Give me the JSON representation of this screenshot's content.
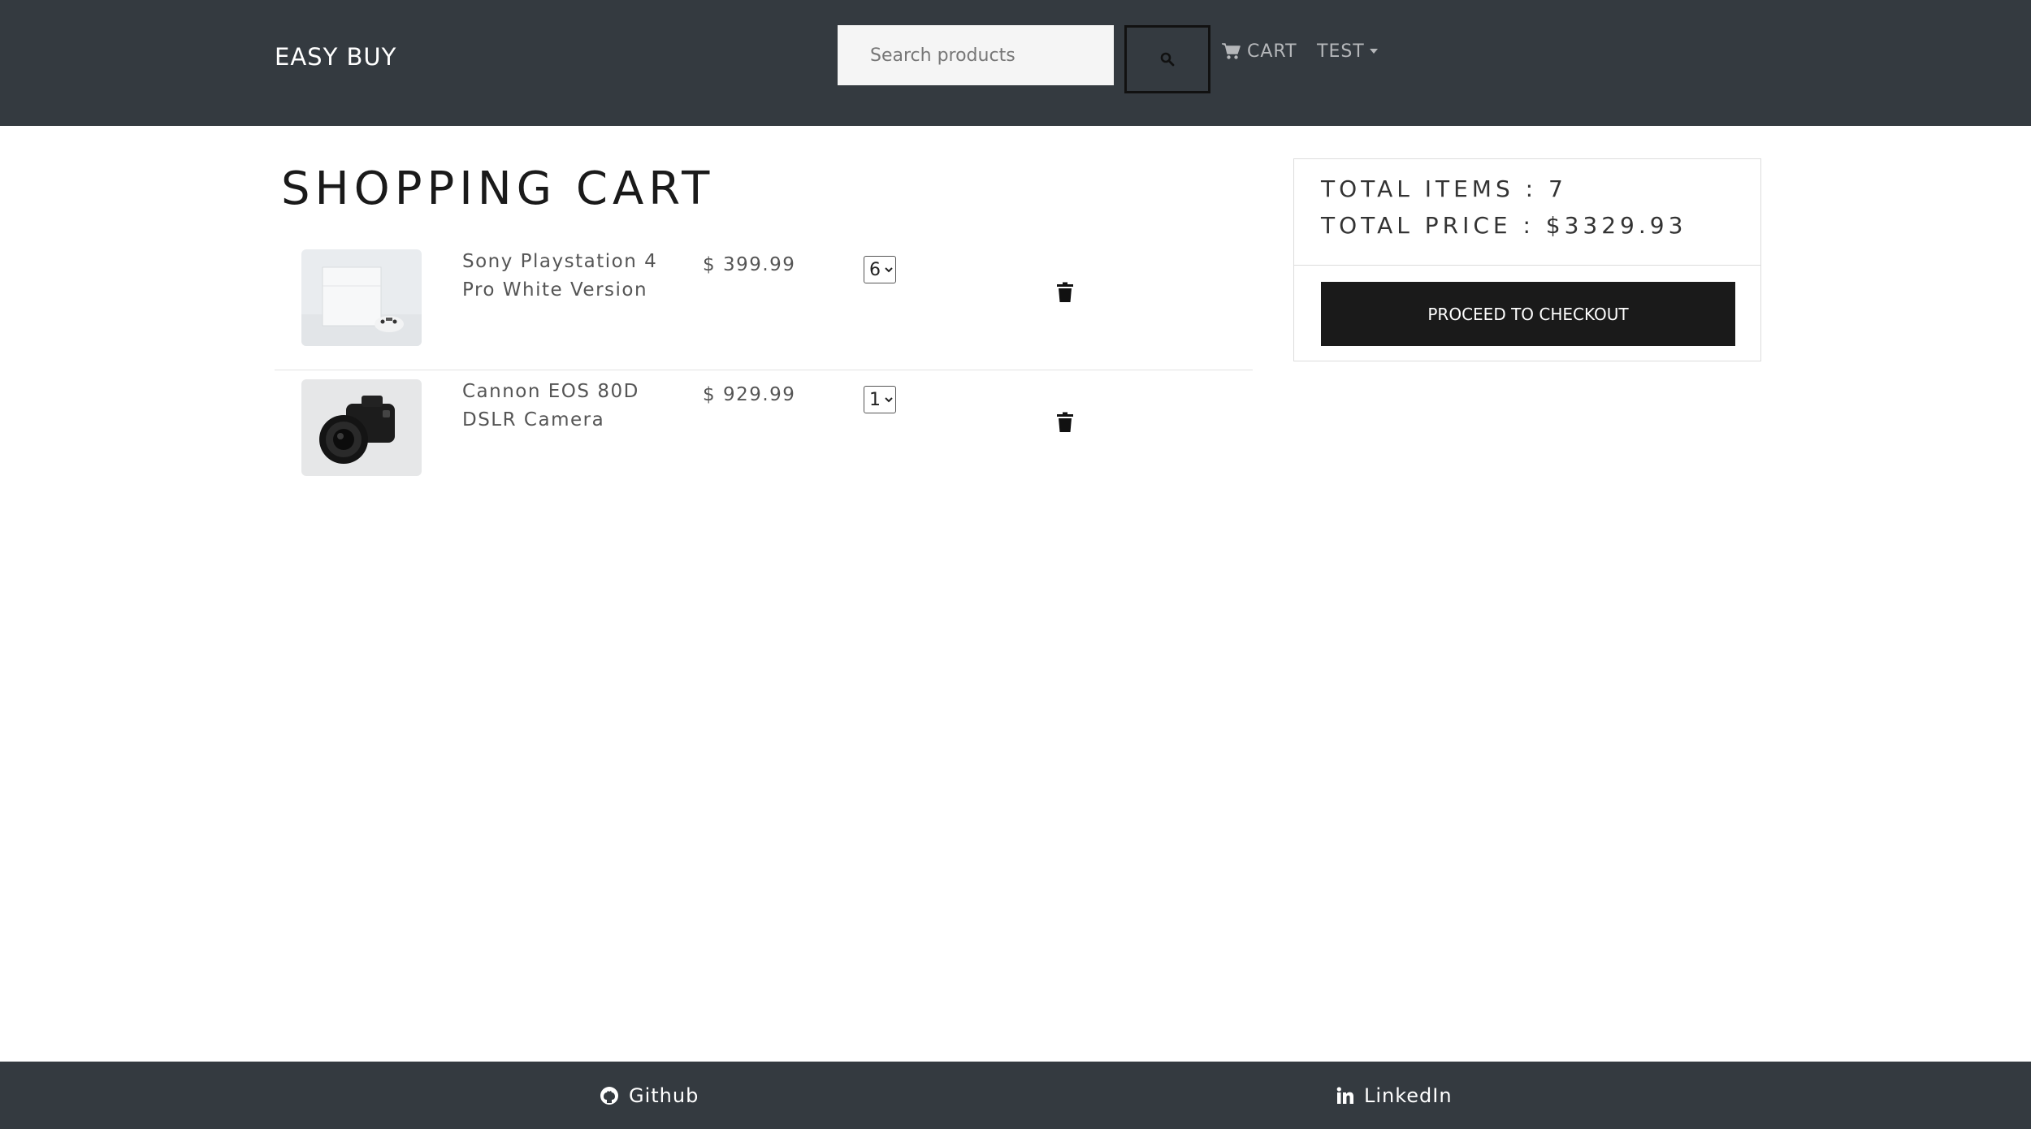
{
  "nav": {
    "brand": "EASY BUY",
    "search_placeholder": "Search products",
    "cart_label": "CART",
    "user_label": "TEST"
  },
  "page_title": "SHOPPING CART",
  "cart_items": [
    {
      "name_line1": "Sony Playstation 4",
      "name_line2": "Pro White Version",
      "price": "$ 399.99",
      "qty": "6",
      "image": "ps4-white-image"
    },
    {
      "name_line1": "Cannon EOS 80D",
      "name_line2": "DSLR Camera",
      "price": "$ 929.99",
      "qty": "1",
      "image": "dslr-camera-image"
    }
  ],
  "summary": {
    "total_items": "TOTAL ITEMS : 7",
    "total_price": "TOTAL PRICE : $3329.93",
    "checkout_label": "PROCEED TO CHECKOUT"
  },
  "footer": {
    "github_label": "Github",
    "linkedin_label": "LinkedIn"
  },
  "colors": {
    "navbar": "#343a40",
    "checkout_button": "#1a1a1a"
  },
  "icons": [
    "search-icon",
    "cart-icon",
    "caret-down-icon",
    "trash-icon",
    "github-icon",
    "linkedin-icon"
  ]
}
